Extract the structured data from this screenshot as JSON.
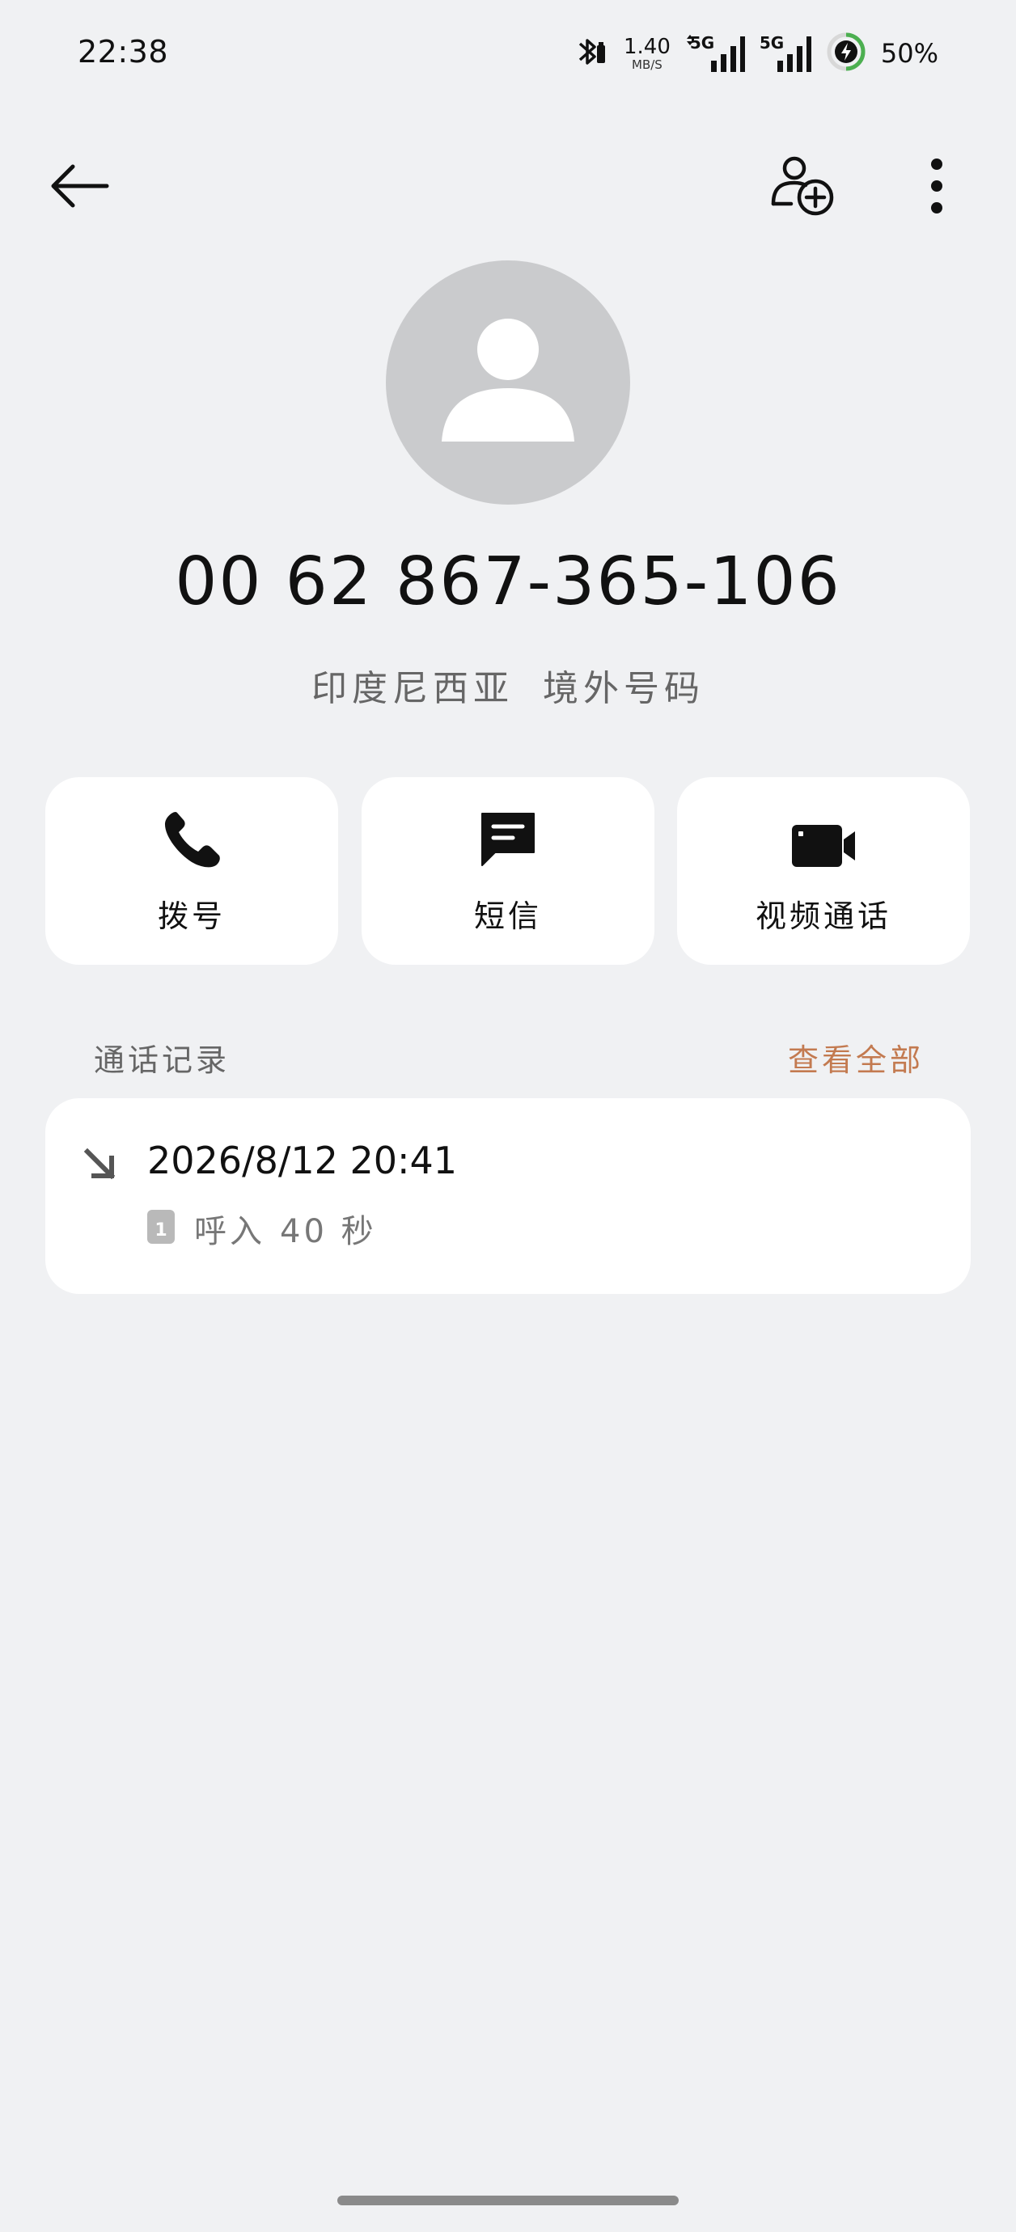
{
  "status_bar": {
    "time": "22:38",
    "net_speed_value": "1.40",
    "net_speed_unit": "MB/S",
    "sim1_label": "5G",
    "sim2_label": "5G",
    "battery_percent": "50%",
    "icons": [
      "bluetooth-icon",
      "signal-5g-icon",
      "signal-5g-icon",
      "battery-charging-icon"
    ]
  },
  "top_bar": {
    "icons": [
      "back-arrow-icon",
      "add-contact-icon",
      "more-vertical-icon"
    ]
  },
  "contact": {
    "phone_number": "00 62 867-365-106",
    "country": "印度尼西亚",
    "number_type": "境外号码"
  },
  "actions": [
    {
      "label": "拨号",
      "icon": "phone-icon"
    },
    {
      "label": "短信",
      "icon": "message-icon"
    },
    {
      "label": "视频通话",
      "icon": "video-icon"
    }
  ],
  "call_log": {
    "title": "通话记录",
    "view_all": "查看全部",
    "entries": [
      {
        "datetime": "2026/8/12 20:41",
        "sim": "1",
        "direction": "呼入",
        "duration": "40 秒",
        "icon": "incoming-call-icon"
      }
    ]
  },
  "colors": {
    "background": "#f0f1f3",
    "card": "#ffffff",
    "accent": "#c37a50",
    "avatar": "#cacbcd",
    "battery_ring": "#4caf50"
  }
}
